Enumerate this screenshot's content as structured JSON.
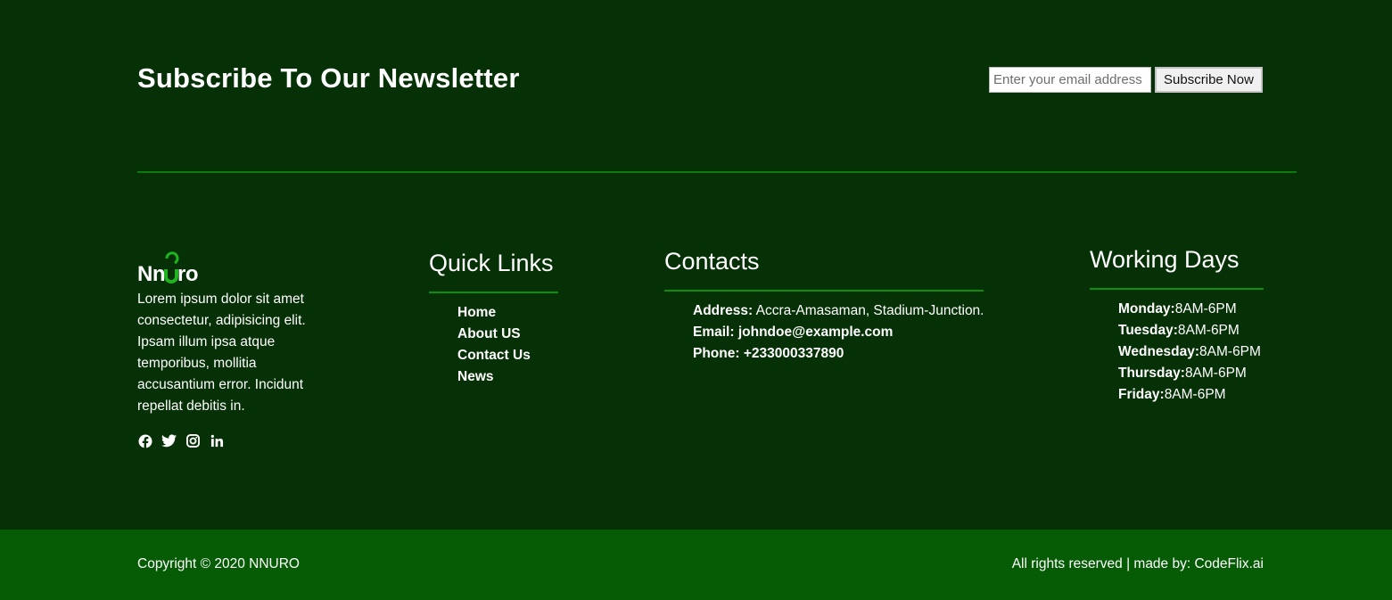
{
  "newsletter": {
    "title": "Subscribe To Our Newsletter",
    "email_placeholder": "Enter your email address",
    "button_label": "Subscribe Now"
  },
  "brand": {
    "logo_text": "Nnuro",
    "description": "Lorem ipsum dolor sit amet consectetur, adipisicing elit. Ipsam illum ipsa atque temporibus, mollitia accusantium error. Incidunt repellat debitis in.",
    "socials": [
      "facebook-icon",
      "twitter-icon",
      "instagram-icon",
      "linkedin-icon"
    ]
  },
  "quick_links": {
    "title": "Quick Links",
    "items": [
      "Home",
      "About US",
      "Contact Us",
      "News"
    ]
  },
  "contacts": {
    "title": "Contacts",
    "address_label": "Address:",
    "address_value": "Accra-Amasaman, Stadium-Junction.",
    "email_label": "Email:",
    "email_value": "johndoe@example.com",
    "phone_label": "Phone:",
    "phone_value": "+233000337890"
  },
  "working_days": {
    "title": "Working Days",
    "days": [
      {
        "day": "Monday:",
        "hours": "8AM-6PM"
      },
      {
        "day": "Tuesday:",
        "hours": "8AM-6PM"
      },
      {
        "day": "Wednesday:",
        "hours": "8AM-6PM"
      },
      {
        "day": "Thursday:",
        "hours": "8AM-6PM"
      },
      {
        "day": "Friday:",
        "hours": "8AM-6PM"
      }
    ]
  },
  "footer": {
    "copyright": "Copyright © 2020 NNURO",
    "rights": "All rights reserved | made by: CodeFlix.ai"
  },
  "colors": {
    "background": "#063106",
    "bottom_bar": "#055c05",
    "accent": "#0c8f0c"
  }
}
